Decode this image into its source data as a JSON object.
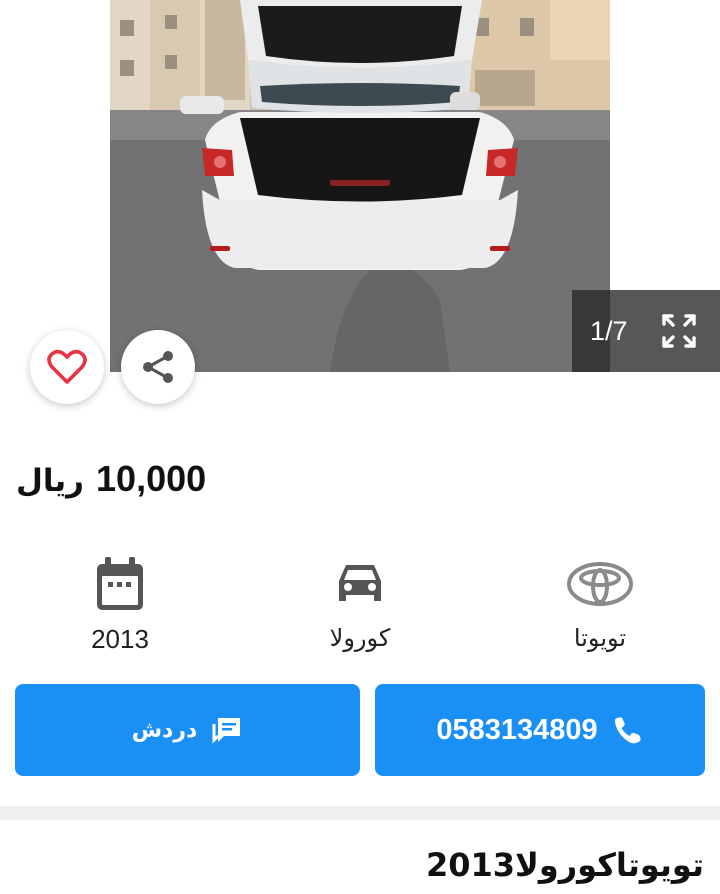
{
  "gallery": {
    "counter": "1/7",
    "icons": {
      "prev": "chevron-left-icon",
      "next": "chevron-right-icon",
      "expand": "expand-icon",
      "favorite": "heart-icon",
      "share": "share-icon"
    }
  },
  "listing": {
    "price": "10,000",
    "currency": "ريال",
    "title": "تويوتاكورولا2013"
  },
  "specs": {
    "make": "تويوتا",
    "model": "كورولا",
    "year": "2013",
    "icons": {
      "make": "toyota-logo-icon",
      "model": "car-icon",
      "year": "calendar-icon"
    }
  },
  "actions": {
    "call_label": "0583134809",
    "chat_label": "دردش",
    "icons": {
      "call": "phone-icon",
      "chat": "chat-icon"
    }
  },
  "colors": {
    "accent": "#1a90f5",
    "heart": "#e8323f",
    "icon_gray": "#555555"
  }
}
